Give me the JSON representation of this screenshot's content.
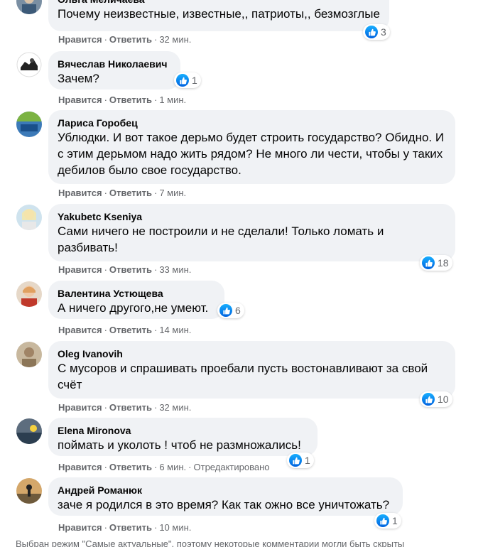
{
  "labels": {
    "like": "Нравится",
    "reply": "Ответить",
    "dot": "·"
  },
  "comments": [
    {
      "author": "Ольга Меличаева",
      "text": "Почему неизвестные, известные,, патриоты,, безмозглые",
      "time": "32 мин.",
      "reactions": "3",
      "avatar_icon": "user-avatar-icon"
    },
    {
      "author": "Вячеслав Николаевич",
      "text": "Зачем?",
      "time": "1 мин.",
      "reactions": "1",
      "avatar_icon": "user-avatar-icon"
    },
    {
      "author": "Лариса Горобец",
      "text": "Ублюдки. И вот такое дерьмо будет строить государство? Обидно. И с этим дерьмом надо жить рядом? Не много ли чести, чтобы у таких дебилов было свое государство.",
      "time": "7 мин.",
      "reactions": "",
      "avatar_icon": "user-avatar-icon"
    },
    {
      "author": "Yakubetc Kseniya",
      "text": "Сами ничего не построили и не сделали! Только ломать и разбивать!",
      "time": "33 мин.",
      "reactions": "18",
      "avatar_icon": "user-avatar-icon"
    },
    {
      "author": "Валентина Устющева",
      "text": "А ничего другого,не умеют.",
      "time": "14 мин.",
      "reactions": "6",
      "avatar_icon": "user-avatar-icon"
    },
    {
      "author": "Oleg Ivanovih",
      "text": "С мусоров и спрашивать проебали пусть востонавливают за свой счёт",
      "time": "32 мин.",
      "reactions": "10",
      "avatar_icon": "user-avatar-icon"
    },
    {
      "author": "Elena Mironova",
      "text": "поймать и уколоть ! чтоб не размножались!",
      "time": "6 мин.",
      "edited": "Отредактировано",
      "reactions": "1",
      "avatar_icon": "user-avatar-icon"
    },
    {
      "author": "Андрей Романюк",
      "text": "заче я родился в это время? Как так ожно все уничтожать?",
      "time": "10 мин.",
      "reactions": "1",
      "avatar_icon": "user-avatar-icon"
    }
  ],
  "footer_note": "Выбран режим \"Самые актуальные\", поэтому некоторые комментарии могли быть скрыты",
  "colors": {
    "bubble": "#f0f2f5",
    "meta": "#65676b",
    "like_blue": "#1877f2"
  }
}
